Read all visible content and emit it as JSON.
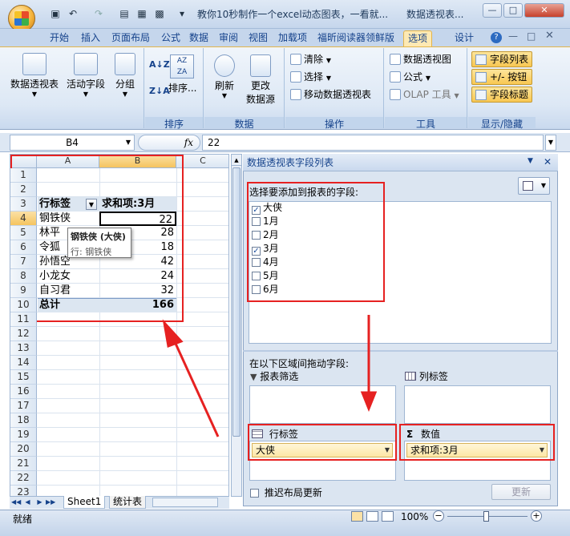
{
  "titlebar": {
    "title": "教你10秒制作一个excel动态图表，一看就...",
    "workbook": "数据透视表..."
  },
  "tabs": [
    "开始",
    "插入",
    "页面布局",
    "公式",
    "数据",
    "审阅",
    "视图",
    "加载项",
    "福昕阅读器领鲜版",
    "选项",
    "设计"
  ],
  "ribbon": {
    "pivot_table_label": "数据透视表",
    "active_field_label": "活动字段",
    "group_label": "分组",
    "sort_label": "排序...",
    "refresh_label": "刷新",
    "change_source_label1": "更改",
    "change_source_label2": "数据源",
    "clear_label": "清除",
    "select_label": "选择",
    "move_label": "移动数据透视表",
    "pivot_chart_label": "数据透视图",
    "formula_label": "公式",
    "olap_label": "OLAP 工具",
    "field_list_label": "字段列表",
    "buttons_label": "+/- 按钮",
    "field_headers_label": "字段标题",
    "groups": [
      "排序",
      "数据",
      "操作",
      "工具",
      "显示/隐藏"
    ]
  },
  "formula_bar": {
    "name_box": "B4",
    "fx": "fx",
    "value": "22"
  },
  "sheet": {
    "columns": [
      "A",
      "B",
      "C"
    ],
    "rows": [
      "1",
      "2",
      "3",
      "4",
      "5",
      "6",
      "7",
      "8",
      "9",
      "10",
      "11",
      "12",
      "13",
      "14",
      "15",
      "16",
      "17",
      "18",
      "19",
      "20",
      "21",
      "22",
      "23"
    ],
    "header_a": "行标签",
    "header_b": "求和项:3月",
    "data": [
      {
        "name": "钢铁侠",
        "value": "22"
      },
      {
        "name": "林平",
        "value": "28"
      },
      {
        "name": "令狐",
        "value": "18"
      },
      {
        "name": "孙悟空",
        "value": "42"
      },
      {
        "name": "小龙女",
        "value": "24"
      },
      {
        "name": "自习君",
        "value": "32"
      }
    ],
    "total_label": "总计",
    "total_value": "166",
    "tooltip_title": "钢铁侠 (大侠)",
    "tooltip_sub": "行: 钢铁侠",
    "sheet_tabs": [
      "Sheet1",
      "统计表"
    ]
  },
  "pivot_pane": {
    "title": "数据透视表字段列表",
    "choose_label": "选择要添加到报表的字段:",
    "fields": [
      {
        "label": "大侠",
        "checked": true
      },
      {
        "label": "1月",
        "checked": false
      },
      {
        "label": "2月",
        "checked": false
      },
      {
        "label": "3月",
        "checked": true
      },
      {
        "label": "4月",
        "checked": false
      },
      {
        "label": "5月",
        "checked": false
      },
      {
        "label": "6月",
        "checked": false
      }
    ],
    "drag_label": "在以下区域间拖动字段:",
    "filter_label": "报表筛选",
    "column_label": "列标签",
    "row_label": "行标签",
    "values_label": "数值",
    "row_item": "大侠",
    "value_item": "求和项:3月",
    "defer_label": "推迟布局更新",
    "update_label": "更新"
  },
  "status": {
    "ready": "就绪",
    "zoom": "100%"
  },
  "colors": {
    "highlight": "#e62121",
    "ribbon": "#dde8f5",
    "accent": "#15428b"
  }
}
